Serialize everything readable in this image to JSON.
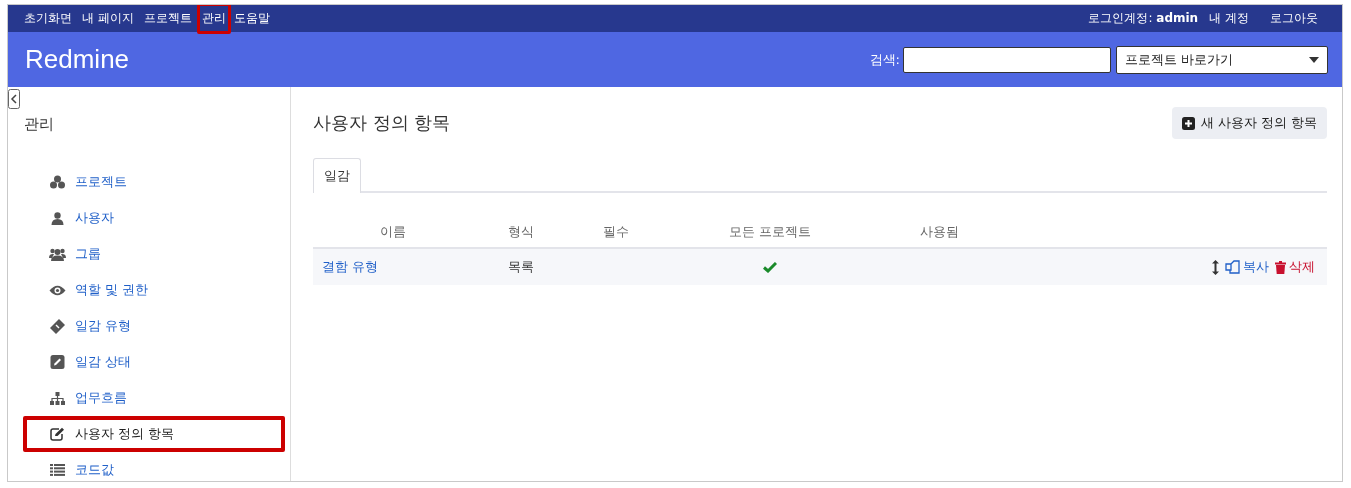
{
  "top_menu": {
    "items": [
      {
        "label": "초기화면",
        "highlighted": false
      },
      {
        "label": "내 페이지",
        "highlighted": false
      },
      {
        "label": "프로젝트",
        "highlighted": false
      },
      {
        "label": "관리",
        "highlighted": true
      },
      {
        "label": "도움말",
        "highlighted": false
      }
    ],
    "logged_in_label": "로그인계정:",
    "user": "admin",
    "account_links": [
      "내 계정",
      "로그아웃"
    ]
  },
  "header": {
    "title": "Redmine",
    "search_label": "검색:",
    "project_jump": "프로젝트 바로가기"
  },
  "sidebar": {
    "title": "관리",
    "items": [
      {
        "label": "프로젝트",
        "kind": "projects",
        "selected": false,
        "highlighted": false
      },
      {
        "label": "사용자",
        "kind": "user",
        "selected": false,
        "highlighted": false
      },
      {
        "label": "그룹",
        "kind": "group",
        "selected": false,
        "highlighted": false
      },
      {
        "label": "역할 및 권한",
        "kind": "eye",
        "selected": false,
        "highlighted": false
      },
      {
        "label": "일감 유형",
        "kind": "ticket",
        "selected": false,
        "highlighted": false
      },
      {
        "label": "일감 상태",
        "kind": "pencil",
        "selected": false,
        "highlighted": false
      },
      {
        "label": "업무흐름",
        "kind": "tree",
        "selected": false,
        "highlighted": false
      },
      {
        "label": "사용자 정의 항목",
        "kind": "edit",
        "selected": true,
        "highlighted": true
      },
      {
        "label": "코드값",
        "kind": "list",
        "selected": false,
        "highlighted": false
      }
    ]
  },
  "content": {
    "title": "사용자 정의 항목",
    "new_button": "새 사용자 정의 항목",
    "tabs": [
      {
        "label": "일감",
        "selected": true
      }
    ],
    "table": {
      "columns": [
        "이름",
        "형식",
        "필수",
        "모든 프로젝트",
        "사용됨"
      ],
      "rows": [
        {
          "name": "결함 유형",
          "format": "목록",
          "all_projects": true,
          "copy": "복사",
          "delete": "삭제"
        }
      ]
    }
  }
}
